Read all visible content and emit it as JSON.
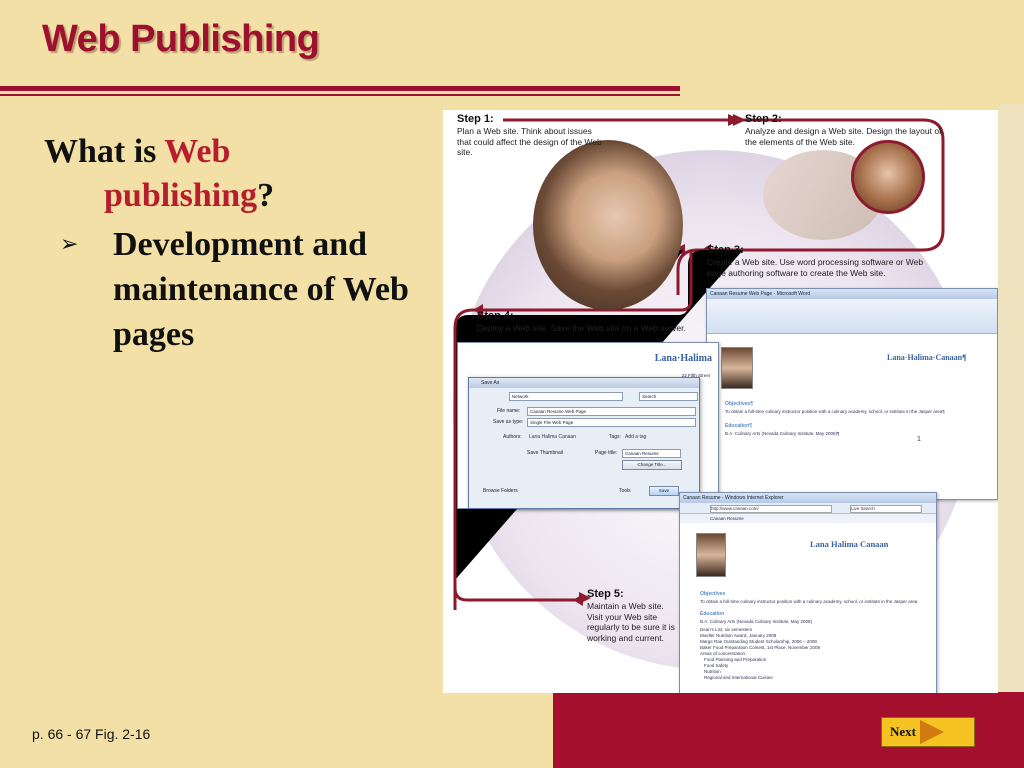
{
  "slide": {
    "title": "Web Publishing",
    "question_prefix": "What is ",
    "question_highlight_1": "Web",
    "question_highlight_2": "publishing",
    "question_suffix": "?",
    "bullet_symbol": "➢",
    "bullet_text": "Development and maintenance of Web pages",
    "caption": "p. 66 - 67 Fig. 2-16",
    "next_label": "Next"
  },
  "colors": {
    "accent": "#9e1030",
    "background": "#f3e0a6",
    "button": "#f5c422"
  },
  "figure": {
    "step1": {
      "title": "Step 1:",
      "text": "Plan a Web site. Think about issues that could affect the design of the Web site."
    },
    "step2": {
      "title": "Step 2:",
      "text": "Analyze and design a Web site. Design the layout of the elements of the Web site."
    },
    "step3": {
      "title": "Step 3:",
      "text": "Create a Web site. Use word processing software or Web page authoring software to create the Web site."
    },
    "step4": {
      "title": "Step 4:",
      "text": "Deploy a Web site. Save the Web site on a Web server."
    },
    "step5": {
      "title": "Step 5:",
      "text": "Maintain a Web site. Visit your Web site regularly to be sure it is working and current."
    },
    "word_title": "Canaan Resume Web Page - Microsoft Word",
    "resume_name": "Lana·Halima·Canaan¶",
    "resume_name_short": "Lana·Halima",
    "resume_address": "22 Fifth Street",
    "objectives": "Objectives¶",
    "objective_text": "To obtain a full-time culinary instructor position with a culinary academy, school, or institute in the Jasper area¶",
    "education": "Education¶",
    "school": "B.A. Culinary Arts (Nevada Culinary Institute, May 2008)¶",
    "page_num": "1",
    "save_as": {
      "title": "Save As",
      "location": "Network",
      "search": "Search",
      "file_name_label": "File name:",
      "file_name": "Canaan Resume Web Page",
      "save_type_label": "Save as type:",
      "save_type": "Single File Web Page",
      "authors_label": "Authors:",
      "authors": "Lana Halima Canaan",
      "tags_label": "Tags:",
      "tags": "Add a tag",
      "thumbnail": "Save Thumbnail",
      "page_title_label": "Page title:",
      "page_title": "Canaan Resume",
      "change_title": "Change Title...",
      "browse": "Browse Folders",
      "tools": "Tools",
      "save": "Save"
    },
    "browser": {
      "title": "Canaan Resume - Windows Internet Explorer",
      "url": "http://www.canaan.com/",
      "search": "Live Search",
      "tab": "Canaan Resume",
      "name": "Lana Halima Canaan",
      "objectives": "Objectives",
      "objective_text": "To obtain a full-time culinary instructor position with a culinary academy, school, or institute in the Jasper area.",
      "education": "Education",
      "school": "B.A. Culinary Arts (Nevada Culinary Institute, May 2008)",
      "list": [
        "Dean's List, six semesters",
        "Moeller Nutrition Award, January 2008",
        "Marge Rae Outstanding Student Scholarship, 2006 – 2008",
        "Baker Food Preparation Contest, 1st Place, November 2006",
        "Areas of concentration:",
        "Food Planning and Preparation",
        "Food Safety",
        "Nutrition",
        "Regional and International Cuisine"
      ]
    }
  }
}
